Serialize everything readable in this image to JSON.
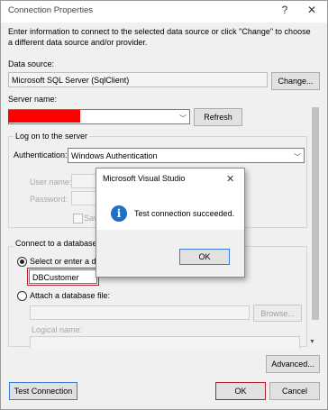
{
  "window": {
    "title": "Connection Properties",
    "help_glyph": "?",
    "close_glyph": "✕"
  },
  "intro": {
    "text": "Enter information to connect to the selected data source or click \"Change\" to choose a different data source and/or provider."
  },
  "data_source": {
    "label": "Data source:",
    "value": "Microsoft SQL Server (SqlClient)",
    "change_button": "Change..."
  },
  "server": {
    "label": "Server name:",
    "refresh_button": "Refresh"
  },
  "logon": {
    "group_label": "Log on to the server",
    "authentication_label": "Authentication:",
    "authentication_value": "Windows Authentication",
    "username_label": "User name:",
    "password_label": "Password:",
    "save_password_label": "Save"
  },
  "database": {
    "group_label": "Connect to a database",
    "select_option_label": "Select or enter a datab",
    "db_name": "DBCustomer",
    "attach_option_label": "Attach a database file:",
    "browse_button": "Browse...",
    "logical_name_label": "Logical name:"
  },
  "buttons": {
    "advanced": "Advanced...",
    "test_connection": "Test Connection",
    "ok": "OK",
    "cancel": "Cancel"
  },
  "message_box": {
    "title": "Microsoft Visual Studio",
    "close_glyph": "✕",
    "icon": "info-icon",
    "icon_glyph": "i",
    "message": "Test connection succeeded.",
    "ok_button": "OK"
  },
  "colors": {
    "accent": "#1d6fc9",
    "redaction": "#ff0000",
    "highlight_frame": "#b5202a"
  }
}
